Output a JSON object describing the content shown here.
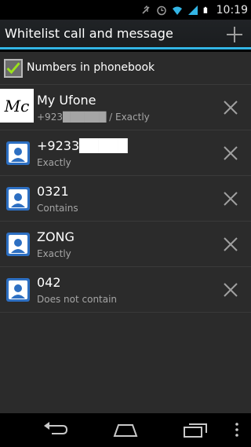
{
  "status_bar": {
    "time": "10:19",
    "icons": [
      "mute-icon",
      "alarm-icon",
      "wifi-icon",
      "signal-icon",
      "battery-icon"
    ]
  },
  "action_bar": {
    "title": "Whitelist call and message",
    "add_icon": "plus-icon"
  },
  "filter": {
    "label": "Numbers in phonebook",
    "checked": true
  },
  "items": [
    {
      "name": "My Ufone",
      "subtitle": "+923██████ / Exactly",
      "avatar": "mc-logo"
    },
    {
      "name": "+9233█████",
      "subtitle": "Exactly",
      "avatar": "contact-icon"
    },
    {
      "name": "0321",
      "subtitle": "Contains",
      "avatar": "contact-icon"
    },
    {
      "name": "ZONG",
      "subtitle": "Exactly",
      "avatar": "contact-icon"
    },
    {
      "name": "042",
      "subtitle": "Does not contain",
      "avatar": "contact-icon"
    }
  ],
  "nav_bar": {
    "buttons": [
      "back-icon",
      "home-icon",
      "recent-apps-icon",
      "menu-icon"
    ]
  },
  "colors": {
    "accent": "#33b5e5",
    "avatar_blue": "#2d6fc2"
  }
}
